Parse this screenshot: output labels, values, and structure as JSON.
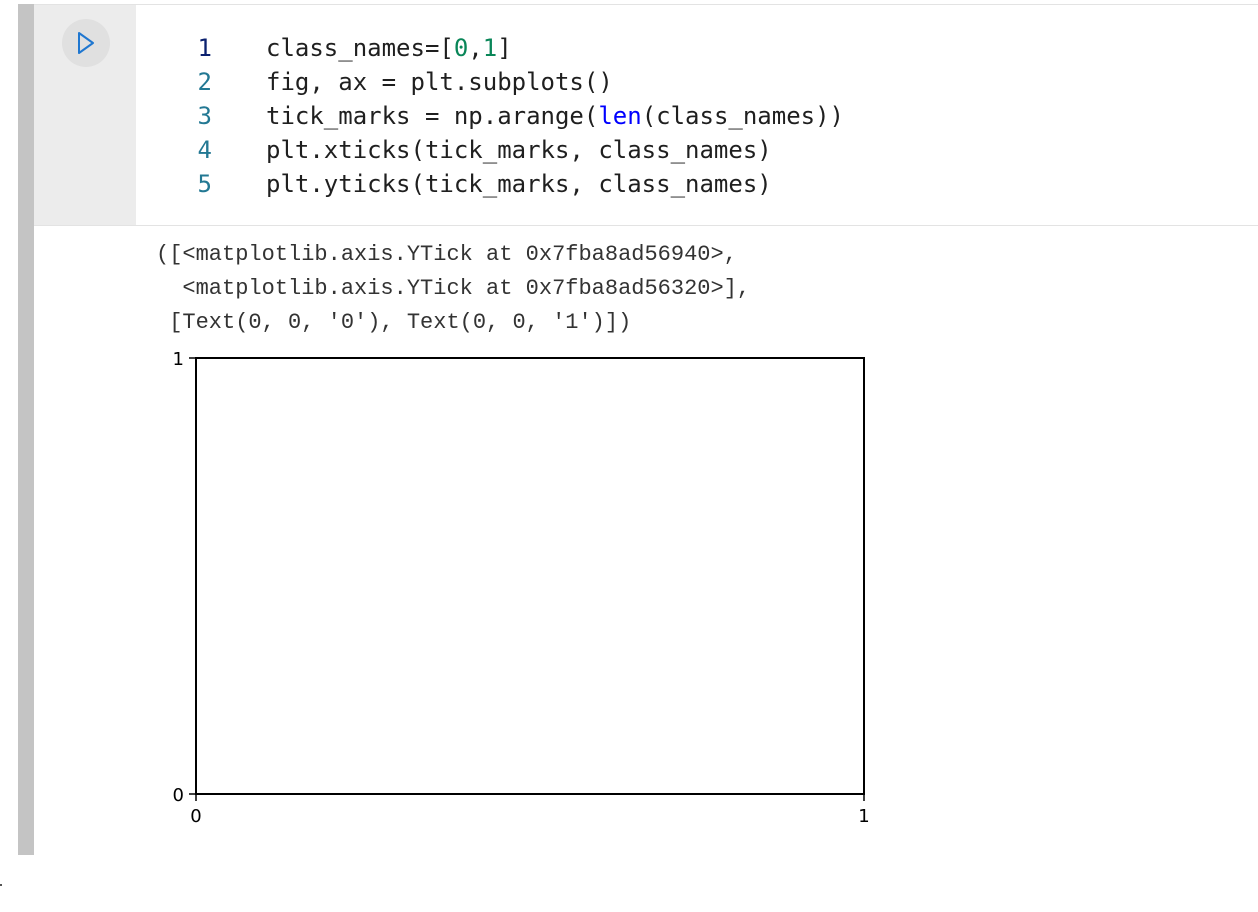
{
  "cell": {
    "run_icon": "play-triangle-icon",
    "lines": [
      {
        "num": "1",
        "segments": [
          {
            "t": "class_names=["
          },
          {
            "t": "0",
            "k": "num"
          },
          {
            "t": ","
          },
          {
            "t": "1",
            "k": "num"
          },
          {
            "t": "]"
          }
        ]
      },
      {
        "num": "2",
        "segments": [
          {
            "t": "fig, ax = plt.subplots()"
          }
        ]
      },
      {
        "num": "3",
        "segments": [
          {
            "t": "tick_marks = np.arange("
          },
          {
            "t": "len",
            "k": "builtin"
          },
          {
            "t": "(class_names))"
          }
        ]
      },
      {
        "num": "4",
        "segments": [
          {
            "t": "plt.xticks(tick_marks, class_names)"
          }
        ]
      },
      {
        "num": "5",
        "segments": [
          {
            "t": "plt.yticks(tick_marks, class_names)"
          }
        ]
      }
    ]
  },
  "output": {
    "text_lines": [
      "([<matplotlib.axis.YTick at 0x7fba8ad56940>,",
      "  <matplotlib.axis.YTick at 0x7fba8ad56320>],",
      " [Text(0, 0, '0'), Text(0, 0, '1')])"
    ]
  },
  "chart_data": {
    "type": "scatter",
    "x": [],
    "y": [],
    "series": [],
    "xticks": [
      0,
      1
    ],
    "yticks": [
      0,
      1
    ],
    "xlim": [
      0,
      1
    ],
    "ylim": [
      0,
      1
    ],
    "grid": false
  },
  "colors": {
    "line_number": "#237893",
    "number_token": "#098658",
    "builtin_token": "#0000ff",
    "run_icon": "#1f77d0"
  }
}
